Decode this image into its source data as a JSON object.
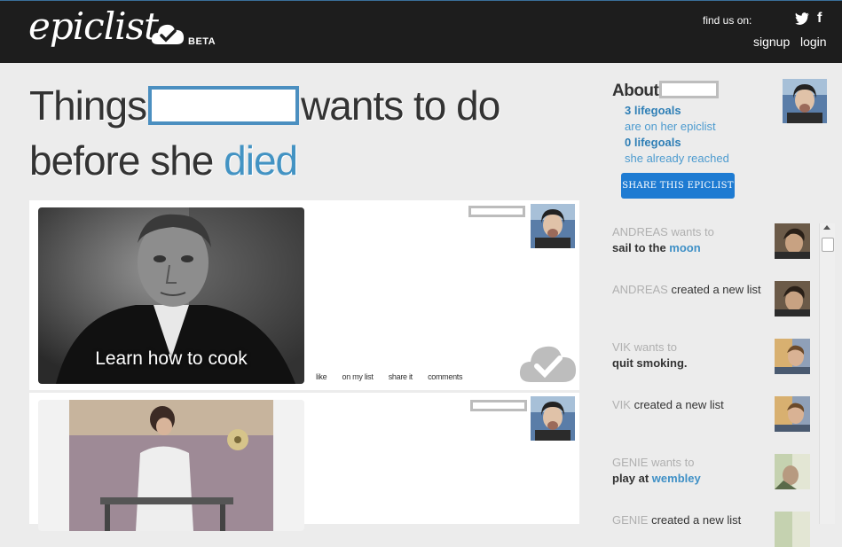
{
  "header": {
    "logo_text": "epiclist",
    "beta_label": "BETA",
    "findus_label": "find us on:",
    "signup_label": "signup",
    "login_label": "login",
    "social_icons": [
      "twitter-icon",
      "facebook-icon"
    ]
  },
  "headline": {
    "part1": "Things",
    "part2": "wants to do",
    "part3": "before she",
    "accent_word": "died"
  },
  "cards": [
    {
      "caption": "Learn how to cook",
      "actions": [
        "like",
        "on my list",
        "share it",
        "comments"
      ]
    },
    {
      "caption": "",
      "actions": []
    }
  ],
  "about": {
    "title": "About",
    "lifegoals_count": "3 lifegoals",
    "lifegoals_text": "are on her epiclist",
    "reached_count": "0 lifegoals",
    "reached_text": "she already reached",
    "share_button": "SHARE THIS EPICLIST"
  },
  "feed": [
    {
      "who": "ANDREAS",
      "verb": " wants to",
      "action": "sail to the ",
      "link": "moon"
    },
    {
      "who": "ANDREAS",
      "verb": " created a new list",
      "action": "",
      "link": ""
    },
    {
      "who": "VIK",
      "verb": " wants to",
      "action": "quit smoking.",
      "link": ""
    },
    {
      "who": "VIK",
      "verb": " created a new list",
      "action": "",
      "link": ""
    },
    {
      "who": "GENIE",
      "verb": " wants to",
      "action": "play at ",
      "link": "wembley"
    },
    {
      "who": "GENIE",
      "verb": " created a new list",
      "action": "",
      "link": ""
    }
  ],
  "colors": {
    "topbar": "#1d1d1d",
    "accent": "#4393c3",
    "button": "#1e7bd2",
    "background": "#ececec"
  }
}
